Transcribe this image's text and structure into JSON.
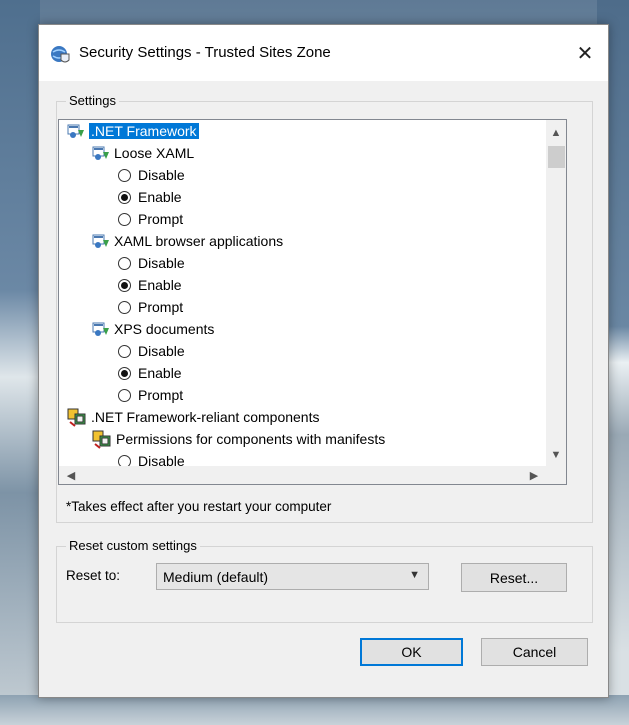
{
  "window": {
    "title": "Security Settings - Trusted Sites Zone",
    "close_glyph": "✕"
  },
  "settings_group": {
    "label": "Settings",
    "tree": {
      "net_framework": ".NET Framework",
      "loose_xaml": "Loose XAML",
      "loose_xaml_options": [
        "Disable",
        "Enable",
        "Prompt"
      ],
      "loose_xaml_selected": "Enable",
      "xaml_browser": "XAML browser applications",
      "xaml_browser_options": [
        "Disable",
        "Enable",
        "Prompt"
      ],
      "xaml_browser_selected": "Enable",
      "xps": "XPS documents",
      "xps_options": [
        "Disable",
        "Enable",
        "Prompt"
      ],
      "xps_selected": "Enable",
      "reliant": ".NET Framework-reliant components",
      "permissions": "Permissions for components with manifests",
      "permissions_options_first": "Disable"
    },
    "note": "*Takes effect after you restart your computer"
  },
  "reset_group": {
    "label": "Reset custom settings",
    "reset_to_label": "Reset to:",
    "selected_level": "Medium (default)",
    "reset_button": "Reset..."
  },
  "buttons": {
    "ok": "OK",
    "cancel": "Cancel"
  },
  "icons": {
    "title": "shield-globe-icon",
    "net_settings": "net-settings-icon",
    "component": "component-icon"
  }
}
